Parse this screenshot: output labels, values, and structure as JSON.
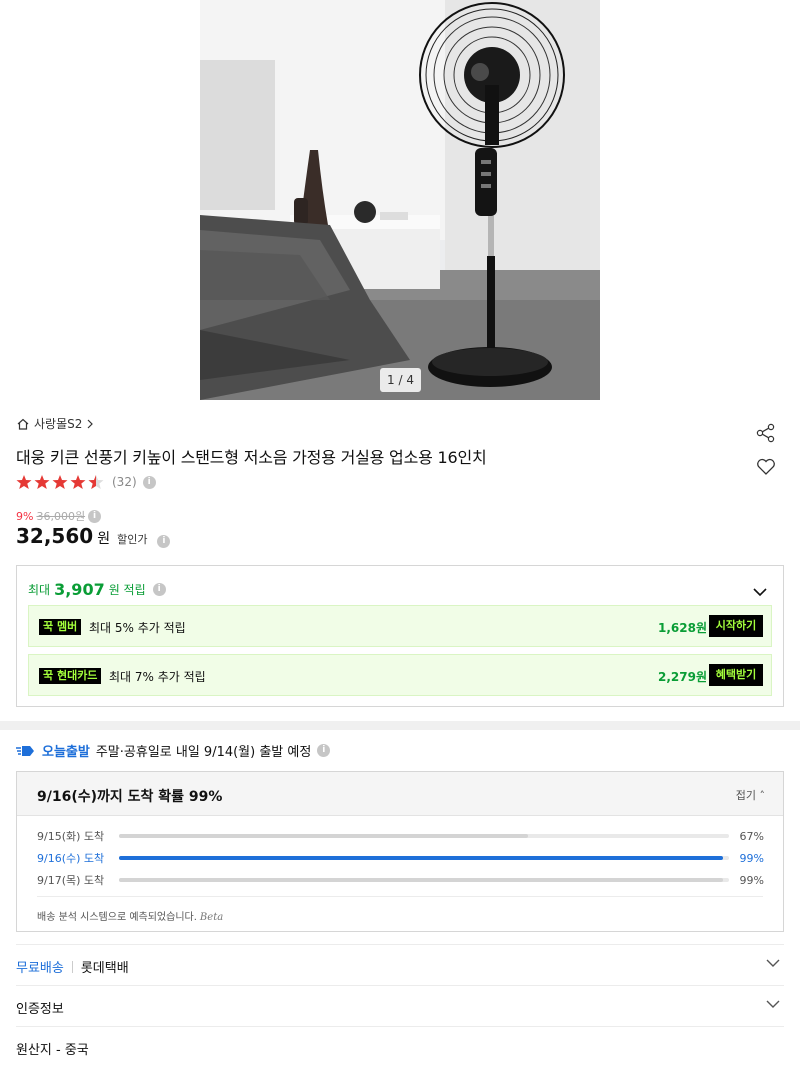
{
  "image": {
    "counter": "1 / 4"
  },
  "store": {
    "name": "사랑몰S2"
  },
  "product": {
    "title": "대웅 키큰 선풍기 키높이 스탠드형 저소음 가정용 거실용 업소용 16인치",
    "rating": 4.5,
    "review_count": "(32)"
  },
  "price": {
    "discount": "9%",
    "original": "36,000원",
    "current": "32,560",
    "currency": "원",
    "label": "할인가"
  },
  "points": {
    "head_prefix": "최대",
    "head_amount": "3,907",
    "head_suffix": "원 적립",
    "rows": [
      {
        "badge": "꾹 멤버",
        "desc": "최대 5% 추가 적립",
        "amount": "1,628원",
        "button": "시작하기"
      },
      {
        "badge": "꾹 현대카드",
        "desc": "최대 7% 추가 적립",
        "amount": "2,279원",
        "button": "혜택받기"
      }
    ]
  },
  "shipping": {
    "label": "오늘출발",
    "message": "주말·공휴일로 내일 9/14(월) 출발 예정",
    "eta_title": "9/16(수)까지 도착 확률 99%",
    "fold": "접기",
    "rows": [
      {
        "date": "9/15(화) 도착",
        "pct": 67,
        "pct_label": "67%",
        "highlight": false
      },
      {
        "date": "9/16(수) 도착",
        "pct": 99,
        "pct_label": "99%",
        "highlight": true
      },
      {
        "date": "9/17(목) 도착",
        "pct": 99,
        "pct_label": "99%",
        "highlight": false
      }
    ],
    "note": "배송 분석 시스템으로 예측되었습니다.",
    "beta": "Beta"
  },
  "delivery": {
    "free": "무료배송",
    "carrier": "롯데택배"
  },
  "cert": {
    "label": "인증정보"
  },
  "origin": {
    "label": "원산지 - 중국"
  },
  "colors": {
    "accent_green": "#0a9d36",
    "accent_blue": "#1e6fd9",
    "sale_red": "#f43142",
    "star": "#e53935"
  }
}
